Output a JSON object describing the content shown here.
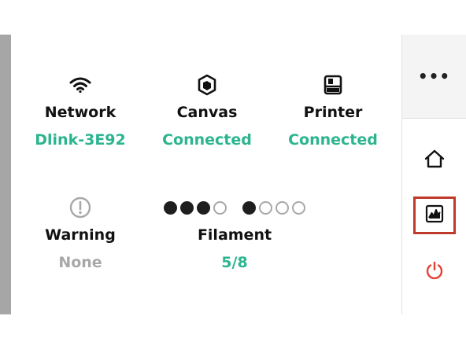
{
  "status": {
    "network": {
      "label": "Network",
      "value": "Dlink-3E92",
      "icon": "wifi-icon"
    },
    "canvas": {
      "label": "Canvas",
      "value": "Connected",
      "icon": "canvas-cube-icon"
    },
    "printer": {
      "label": "Printer",
      "value": "Connected",
      "icon": "printer-icon"
    },
    "warning": {
      "label": "Warning",
      "value": "None",
      "icon": "warning-circle-icon"
    },
    "filament": {
      "label": "Filament",
      "value": "5/8",
      "level_filled": 4,
      "level_total": 8
    }
  },
  "rail": {
    "more_label": "•••",
    "items": [
      "home-icon",
      "stats-chart-icon",
      "power-icon"
    ]
  },
  "colors": {
    "accent": "#2bb58f",
    "muted": "#a8a8a8",
    "selected_border": "#c0392b",
    "power": "#e34234"
  }
}
